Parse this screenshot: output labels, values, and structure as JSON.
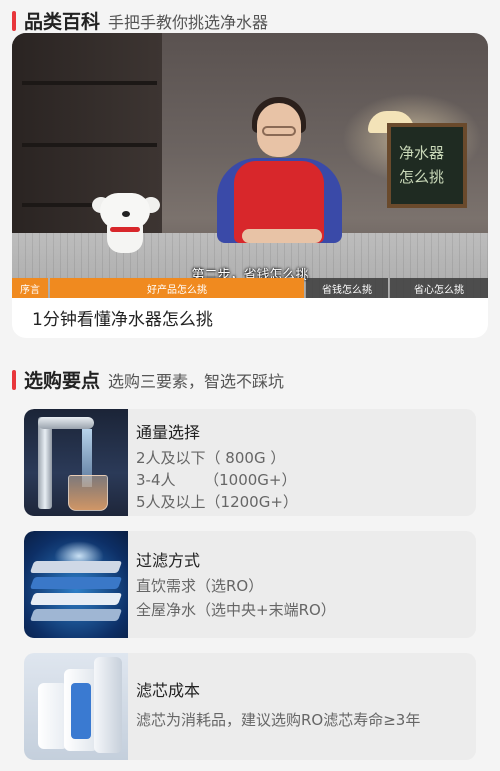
{
  "section1": {
    "title": "品类百科",
    "subtitle": "手把手教你挑选净水器"
  },
  "video": {
    "subtitle": "第二步，省钱怎么挑",
    "chalkboard": "净水器\n怎么挑",
    "chapters": [
      {
        "label": "序言"
      },
      {
        "label": "好产品怎么挑"
      },
      {
        "label": "省钱怎么挑"
      },
      {
        "label": "省心怎么挑"
      }
    ],
    "caption": "1分钟看懂净水器怎么挑"
  },
  "section2": {
    "title": "选购要点",
    "subtitle": "选购三要素，智选不踩坑"
  },
  "features": [
    {
      "title": "通量选择",
      "lines": [
        "2人及以下（ 800G ）",
        "3-4人      （1000G+）",
        "5人及以上（1200G+）"
      ],
      "image_icon": "faucet-water-icon"
    },
    {
      "title": "过滤方式",
      "lines": [
        "直饮需求（选RO）",
        "全屋净水（选中央+末端RO）"
      ],
      "image_icon": "filter-layers-icon"
    },
    {
      "title": "滤芯成本",
      "lines": [
        "滤芯为消耗品，建议选购RO滤芯寿命≥3年"
      ],
      "image_icon": "filter-cartridge-icon"
    }
  ],
  "colors": {
    "accent": "#e8363b",
    "chapter_active": "#f08a1f"
  }
}
